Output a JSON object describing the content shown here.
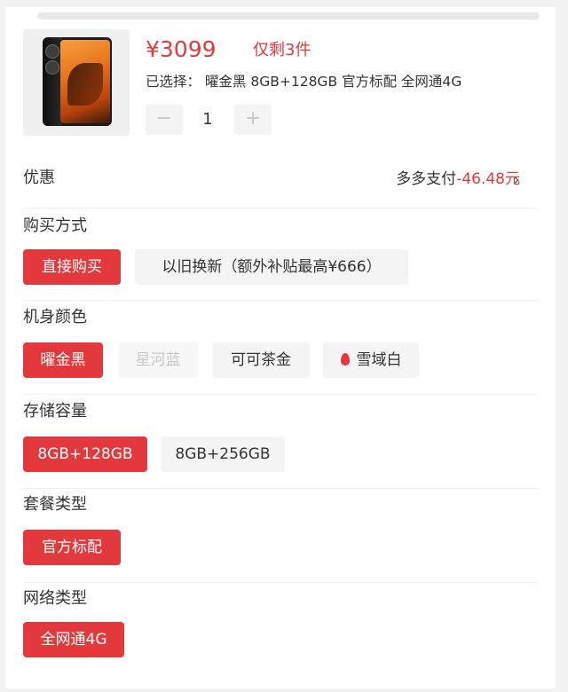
{
  "product": {
    "price": "¥3099",
    "stock_note": "仅剩3件",
    "selected_text": "已选择： 曜金黑 8GB+128GB 官方标配 全网通4G",
    "quantity": "1",
    "minus_label": "−",
    "plus_label": "+"
  },
  "discount": {
    "label": "优惠",
    "method": "多多支付",
    "amount": "-46.48元",
    "chevron": "›"
  },
  "purchase_method": {
    "label": "购买方式",
    "options": [
      "直接购买",
      "以旧换新（额外补贴最高¥666）"
    ],
    "selected": "直接购买"
  },
  "color": {
    "label": "机身颜色",
    "options": [
      "曜金黑",
      "星河蓝",
      "可可茶金",
      "雪域白"
    ],
    "selected": "曜金黑",
    "disabled": [
      "星河蓝"
    ],
    "hot_icon": "flame-icon"
  },
  "storage": {
    "label": "存储容量",
    "options": [
      "8GB+128GB",
      "8GB+256GB"
    ],
    "selected": "8GB+128GB"
  },
  "package": {
    "label": "套餐类型",
    "options": [
      "官方标配"
    ],
    "selected": "官方标配"
  },
  "network": {
    "label": "网络类型",
    "options": [
      "全网通4G"
    ],
    "selected": "全网通4G"
  },
  "colors": {
    "accent": "#e4393c",
    "chip_bg": "#f4f4f4"
  }
}
